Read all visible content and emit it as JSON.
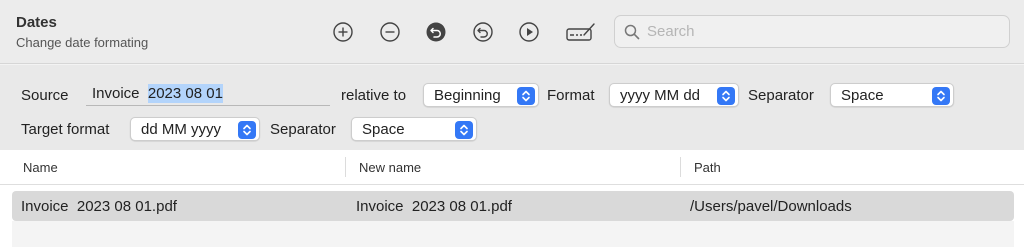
{
  "header": {
    "title": "Dates",
    "subtitle": "Change date formating"
  },
  "toolbar": {
    "buttons": [
      "plus-circle-icon",
      "minus-circle-icon",
      "undo-filled-icon",
      "undo-outline-icon",
      "play-icon",
      "signature-icon"
    ]
  },
  "search": {
    "placeholder": "Search",
    "value": ""
  },
  "options": {
    "source_label": "Source",
    "source_prefix": "Invoice",
    "source_selected": "2023 08 01",
    "relative_label": "relative to",
    "relative_value": "Beginning",
    "format_label": "Format",
    "format_value": "yyyy MM dd",
    "separator_label": "Separator",
    "separator_value": "Space",
    "target_label": "Target format",
    "target_value": "dd MM yyyy",
    "separator2_label": "Separator",
    "separator2_value": "Space"
  },
  "table": {
    "columns": [
      "Name",
      "New name",
      "Path"
    ],
    "rows": [
      {
        "name": "Invoice  2023 08 01.pdf",
        "new_name": "Invoice  2023 08 01.pdf",
        "path": "/Users/pavel/Downloads"
      }
    ]
  },
  "colors": {
    "accent": "#3478f6",
    "selection": "#b3d4fb",
    "row_selected": "#d9d9d9"
  }
}
